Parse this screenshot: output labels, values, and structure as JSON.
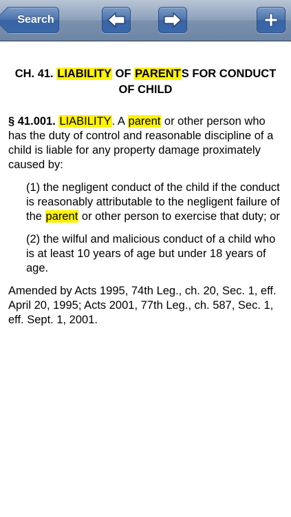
{
  "navbar": {
    "back_label": "Search",
    "prev_icon": "arrow-left-icon",
    "next_icon": "arrow-right-icon",
    "add_icon": "plus-icon"
  },
  "chapter": {
    "prefix": "CH. 41. ",
    "hl1": "LIABILITY",
    "mid": " OF ",
    "hl2": "PARENT",
    "suffix": "S FOR CONDUCT OF CHILD"
  },
  "section": {
    "number": "§ 41.001.",
    "sp": " ",
    "hl_title": "LIABILITY",
    "after_title": ". A ",
    "hl_parent": "parent",
    "rest": " or other person who has the duty of control and reasonable discipline of a child is liable for any property damage proximately caused by:"
  },
  "item1": {
    "before": "(1) the negligent conduct of the child if the conduct is reasonably attributable to the negligent failure of the ",
    "hl": "parent",
    "after": " or other person to exercise that duty; or"
  },
  "item2": {
    "text": "(2) the wilful and malicious conduct of a child who is at least 10 years of age but under 18 years of age."
  },
  "amended": {
    "text": "Amended by Acts 1995, 74th Leg., ch. 20, Sec. 1, eff. April 20, 1995; Acts 2001, 77th Leg., ch. 587, Sec. 1, eff. Sept. 1, 2001."
  },
  "colors": {
    "highlight": "#fff300",
    "navbar": "#8da1ba",
    "button": "#4a72ad"
  }
}
